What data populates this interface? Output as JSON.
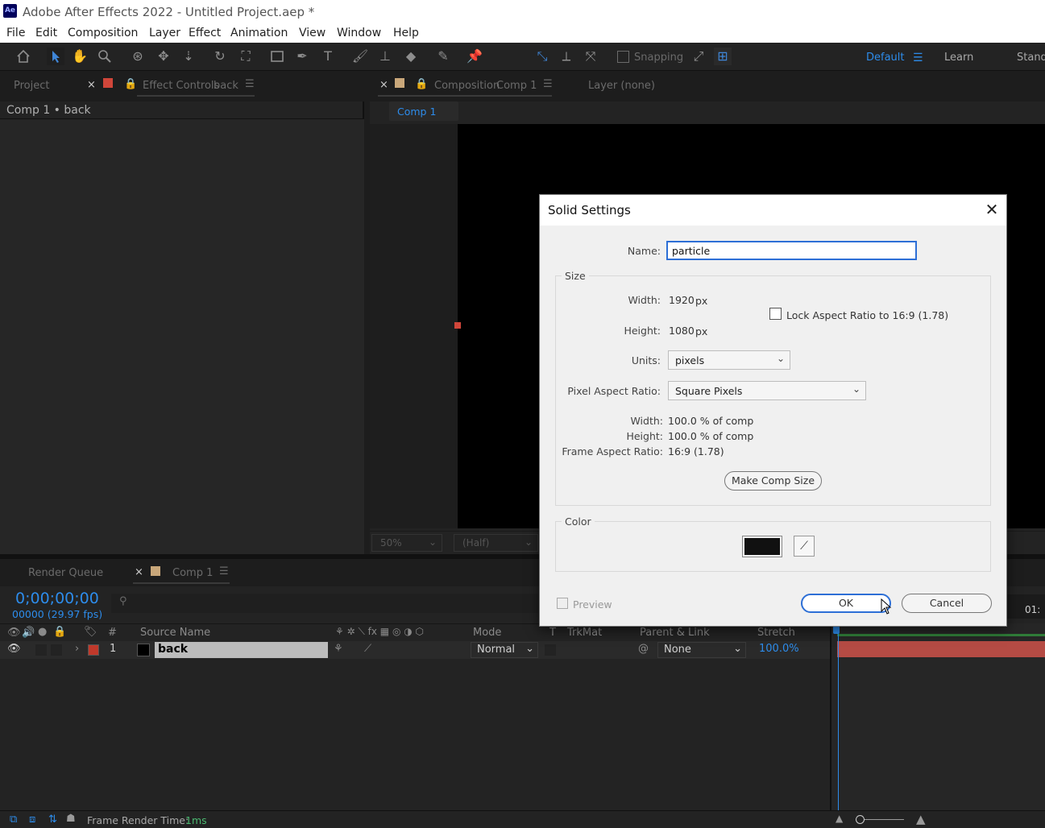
{
  "window": {
    "title": "Adobe After Effects 2022 - Untitled Project.aep *",
    "logo": "Ae"
  },
  "menu": [
    "File",
    "Edit",
    "Composition",
    "Layer",
    "Effect",
    "Animation",
    "View",
    "Window",
    "Help"
  ],
  "toolbar": {
    "snapping_label": "Snapping",
    "workspaces": [
      "Default",
      "Learn",
      "Standa"
    ]
  },
  "left_panel": {
    "tabs": [
      "Project",
      "Effect Controls",
      "back"
    ],
    "breadcrumb": "Comp 1 • back"
  },
  "viewer": {
    "tab_prefix": "Composition",
    "tab_comp": "Comp 1",
    "layer_tab": "Layer (none)",
    "subtab": "Comp 1",
    "zoom": "50%",
    "resolution": "(Half)"
  },
  "dialog": {
    "title": "Solid Settings",
    "name_label": "Name:",
    "name_value": "particle",
    "size_group": "Size",
    "width_label": "Width:",
    "width_value": "1920",
    "height_label": "Height:",
    "height_value": "1080",
    "px": "px",
    "lock_label": "Lock Aspect Ratio to 16:9 (1.78)",
    "units_label": "Units:",
    "units_value": "pixels",
    "par_label": "Pixel Aspect Ratio:",
    "par_value": "Square Pixels",
    "pct_width_label": "Width:",
    "pct_width_value": "100.0 % of comp",
    "pct_height_label": "Height:",
    "pct_height_value": "100.0 % of comp",
    "far_label": "Frame Aspect Ratio:",
    "far_value": "16:9 (1.78)",
    "make_comp_size": "Make Comp Size",
    "color_group": "Color",
    "swatch_color": "#111111",
    "preview_label": "Preview",
    "ok": "OK",
    "cancel": "Cancel"
  },
  "timeline": {
    "tabs": [
      "Render Queue",
      "Comp 1"
    ],
    "timecode": "0;00;00;00",
    "frames": "00000 (29.97 fps)",
    "columns": {
      "number": "#",
      "source_name": "Source Name",
      "mode": "Mode",
      "t": "T",
      "trkmat": "TrkMat",
      "parent": "Parent & Link",
      "stretch": "Stretch"
    },
    "layer": {
      "index": "1",
      "name": "back",
      "mode": "Normal",
      "parent": "None",
      "stretch": "100.0%",
      "label_color": "#c0392b"
    },
    "ruler_label": "01:"
  },
  "status": {
    "frame_render_label": "Frame Render Time:",
    "frame_render_value": "1ms"
  }
}
